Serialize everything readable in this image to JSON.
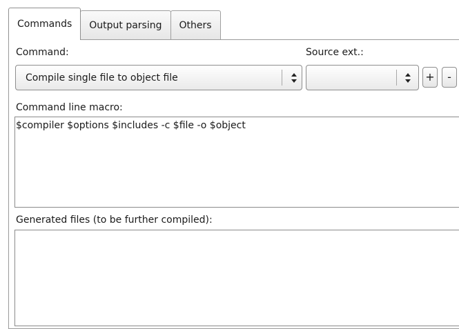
{
  "tabs": [
    {
      "label": "Commands",
      "active": true
    },
    {
      "label": "Output parsing",
      "active": false
    },
    {
      "label": "Others",
      "active": false
    }
  ],
  "command": {
    "label": "Command:",
    "selected": "Compile single file to object file"
  },
  "source_ext": {
    "label": "Source ext.:",
    "selected": "",
    "add_label": "+",
    "remove_label": "-"
  },
  "macro": {
    "label": "Command line macro:",
    "value": "$compiler $options $includes -c $file -o $object"
  },
  "generated": {
    "label": "Generated files (to be further compiled):",
    "value": ""
  }
}
